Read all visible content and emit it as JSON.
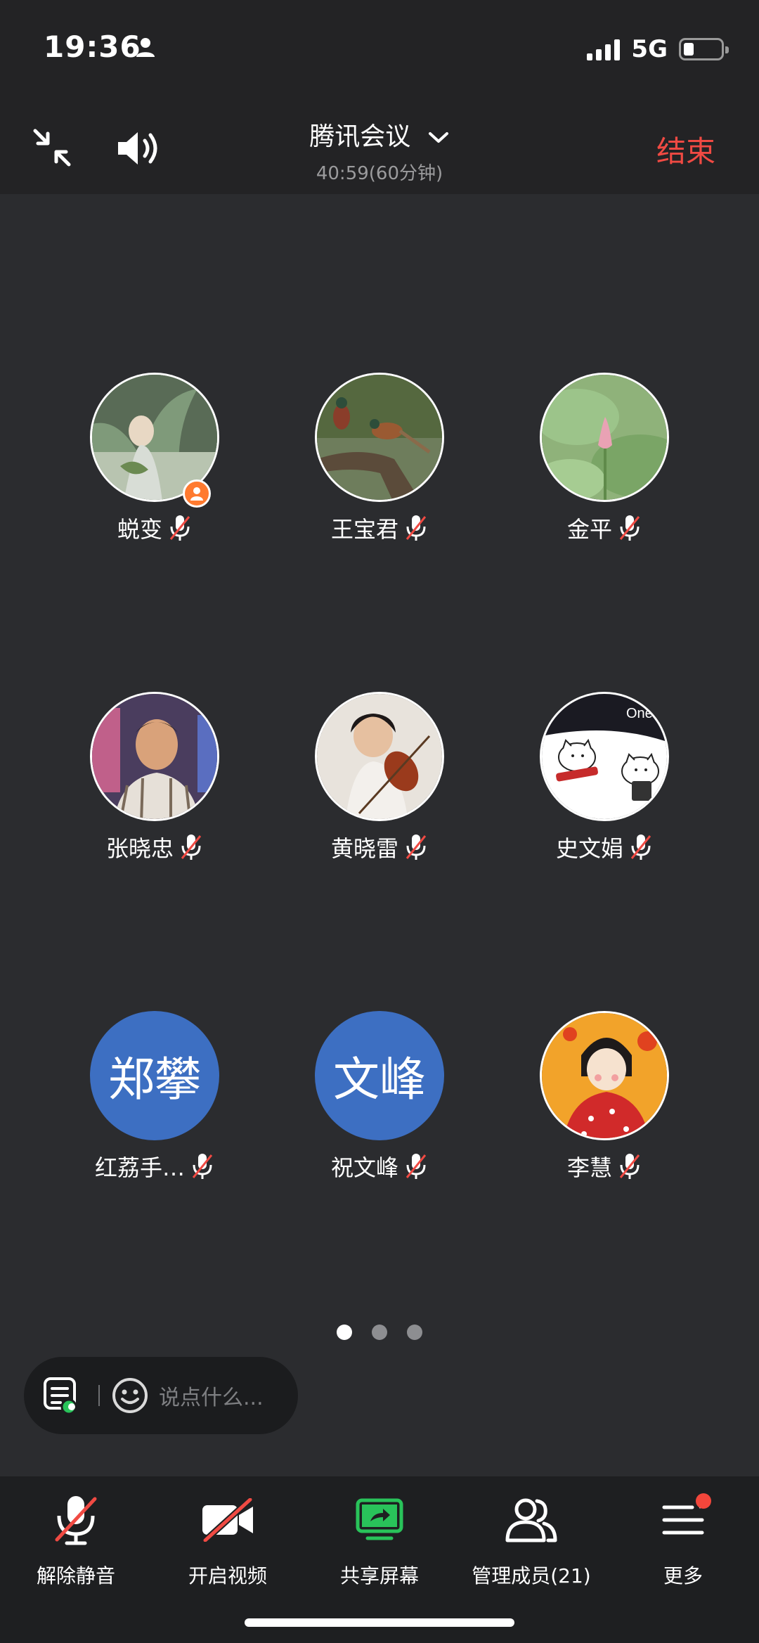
{
  "status_bar": {
    "time": "19:36",
    "network": "5G"
  },
  "header": {
    "title": "腾讯会议",
    "timer": "40:59(60分钟)",
    "end_label": "结束"
  },
  "participants": [
    {
      "name": "蜕变",
      "avatar": "photo-girl-in-meadow",
      "muted": true,
      "host": true
    },
    {
      "name": "王宝君",
      "avatar": "photo-pheasants-on-branch",
      "muted": true
    },
    {
      "name": "金平",
      "avatar": "photo-lotus-bud",
      "muted": true
    },
    {
      "name": "张晓忠",
      "avatar": "photo-man-portrait",
      "muted": true
    },
    {
      "name": "黄晓雷",
      "avatar": "photo-girl-with-violin",
      "muted": true
    },
    {
      "name": "史文娟",
      "avatar": "cartoon-cats",
      "avatar_text_overlay": "One",
      "muted": true
    },
    {
      "name": "红荔手…",
      "avatar_text": "郑攀",
      "muted": true
    },
    {
      "name": "祝文峰",
      "avatar_text": "文峰",
      "muted": true
    },
    {
      "name": "李慧",
      "avatar": "illustration-girl-red-dress",
      "muted": true
    }
  ],
  "pager": {
    "pages": 3,
    "active": 1
  },
  "chat": {
    "placeholder": "说点什么..."
  },
  "toolbar": {
    "unmute_label": "解除静音",
    "video_label": "开启视频",
    "share_label": "共享屏幕",
    "members_label": "管理成员(21)",
    "more_label": "更多"
  },
  "colors": {
    "accent_red": "#f04a43",
    "share_green": "#29c35a",
    "text_avatar_blue": "#3d6fc2",
    "host_badge_orange": "#ff7a2f"
  }
}
